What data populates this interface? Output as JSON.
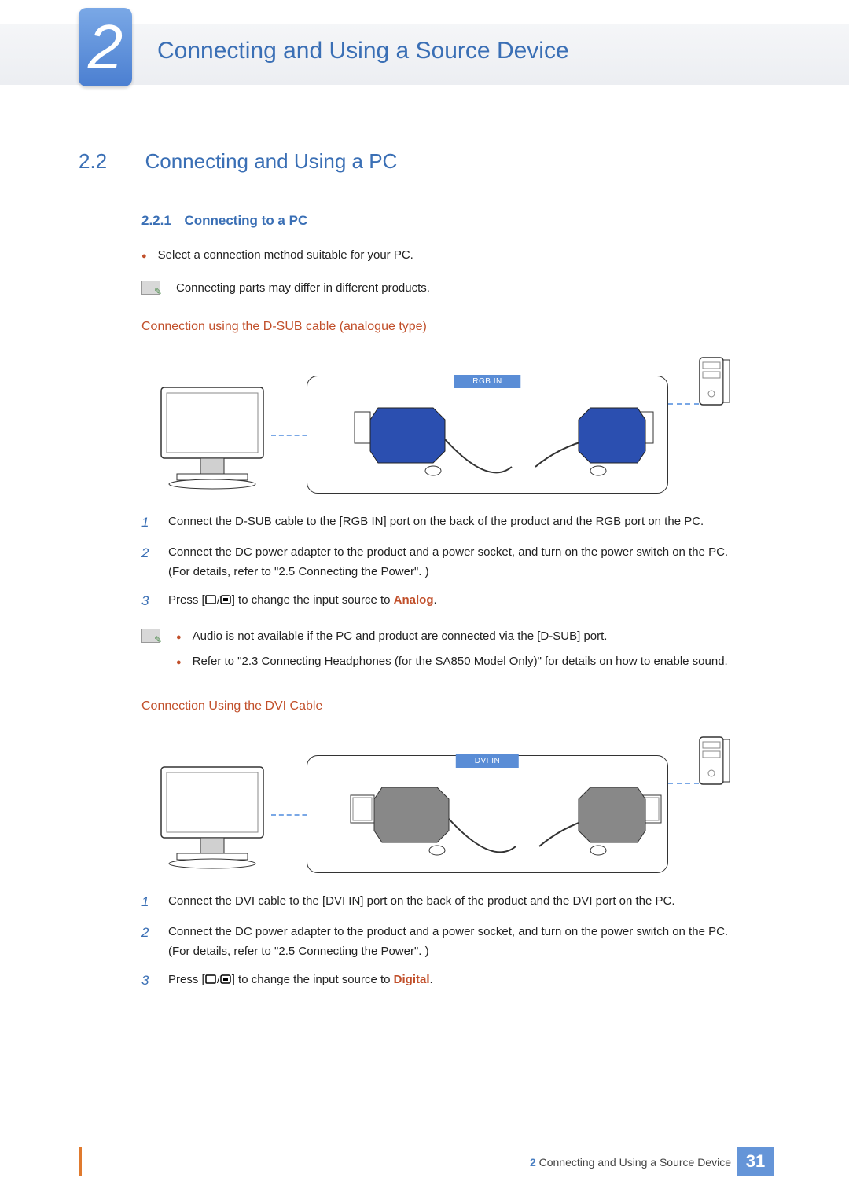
{
  "chapter": {
    "number": "2",
    "title": "Connecting and Using a Source Device"
  },
  "section": {
    "number": "2.2",
    "title": "Connecting and Using a PC"
  },
  "subsection": {
    "number": "2.2.1",
    "title": "Connecting to a PC"
  },
  "intro_bullet": "Select a connection method suitable for your PC.",
  "intro_note": "Connecting parts may differ in different products.",
  "dsub": {
    "heading": "Connection using the D-SUB cable (analogue type)",
    "port_label": "RGB IN",
    "steps": [
      "Connect the D-SUB cable to the [RGB IN] port on the back of the product and the RGB port on the PC.",
      "Connect the DC power adapter to the product and a power socket, and turn on the power switch on the PC.",
      "(For details, refer to \"2.5 Connecting the Power\". )"
    ],
    "step3_pre": "Press [",
    "step3_mid": "] to change the input source to ",
    "step3_source": "Analog",
    "step3_post": ".",
    "notes": [
      "Audio is not available if the PC and product are connected via the [D-SUB] port.",
      "Refer to \"2.3 Connecting Headphones (for the SA850 Model Only)\" for details on how to enable sound."
    ]
  },
  "dvi": {
    "heading": "Connection Using the DVI Cable",
    "port_label": "DVI IN",
    "steps": [
      "Connect the DVI cable to the [DVI IN] port on the back of the product and the DVI port on the PC.",
      "Connect the DC power adapter to the product and a power socket, and turn on the power switch on the PC.",
      "(For details, refer to \"2.5 Connecting the Power\". )"
    ],
    "step3_pre": "Press [",
    "step3_mid": "] to change the input source to ",
    "step3_source": "Digital",
    "step3_post": "."
  },
  "footer": {
    "chapter_num": "2",
    "chapter_title": "Connecting and Using a Source Device",
    "page": "31"
  },
  "icons": {
    "note": "note-icon",
    "source_button": "source-button-icon"
  }
}
